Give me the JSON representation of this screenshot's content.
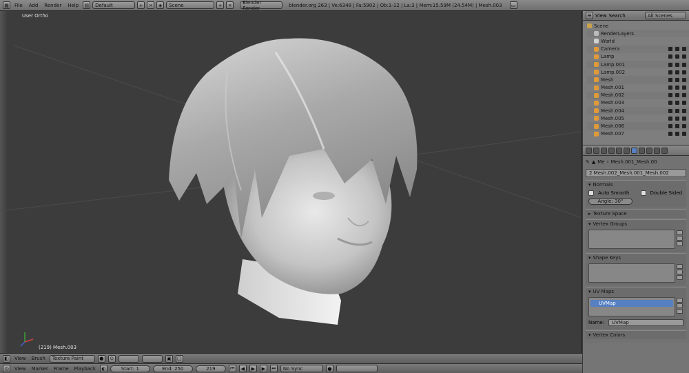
{
  "topbar": {
    "menus": [
      "File",
      "Add",
      "Render",
      "Help"
    ],
    "layout": "Default",
    "scene": "Scene",
    "engine": "Blender Render",
    "stats": "blender.org 263 | Ve:6348 | Fa:5902 | Ob:1-12 | La:3 | Mem:15.59M (24.54M) | Mesh.003"
  },
  "viewport": {
    "view_label": "User Ortho",
    "object_label": "(219) Mesh.003"
  },
  "viewport_footer": {
    "menus": [
      "View",
      "Brush"
    ],
    "mode": "Texture Paint"
  },
  "timeline": {
    "menus": [
      "View",
      "Marker",
      "Frame",
      "Playback"
    ],
    "start": "Start: 1",
    "end": "End: 250",
    "current": "219",
    "sync": "No Sync"
  },
  "outliner": {
    "header_menus": [
      "View",
      "Search"
    ],
    "filter": "All Scenes",
    "items": [
      {
        "label": "Scene",
        "color": "#c9a24a"
      },
      {
        "label": "RenderLayers",
        "color": "#bbbbbb"
      },
      {
        "label": "World",
        "color": "#d0d0d0"
      },
      {
        "label": "Camera",
        "color": "#e09a3a"
      },
      {
        "label": "Lamp",
        "color": "#e09a3a"
      },
      {
        "label": "Lamp.001",
        "color": "#e09a3a"
      },
      {
        "label": "Lamp.002",
        "color": "#e09a3a"
      },
      {
        "label": "Mesh",
        "color": "#e09a3a"
      },
      {
        "label": "Mesh.001",
        "color": "#e09a3a"
      },
      {
        "label": "Mesh.002",
        "color": "#e09a3a"
      },
      {
        "label": "Mesh.003",
        "color": "#e09a3a"
      },
      {
        "label": "Mesh.004",
        "color": "#e09a3a"
      },
      {
        "label": "Mesh.005",
        "color": "#e09a3a"
      },
      {
        "label": "Mesh.006",
        "color": "#e09a3a"
      },
      {
        "label": "Mesh.007",
        "color": "#e09a3a"
      }
    ]
  },
  "properties": {
    "breadcrumb_a": "Me",
    "breadcrumb_b": "Mesh.001_Mesh.00",
    "mesh_name": "2 Mesh.002_Mesh.001_Mesh.002",
    "normals": {
      "title": "Normals",
      "auto_smooth": "Auto Smooth",
      "double_sided": "Double Sided",
      "angle": "Angle: 30°"
    },
    "texture_space": "Texture Space",
    "vertex_groups": "Vertex Groups",
    "shape_keys": "Shape Keys",
    "uv_maps": {
      "title": "UV Maps",
      "item": "UVMap",
      "name_label": "Name:",
      "name_value": "UVMap"
    },
    "vertex_colors": "Vertex Colors"
  }
}
